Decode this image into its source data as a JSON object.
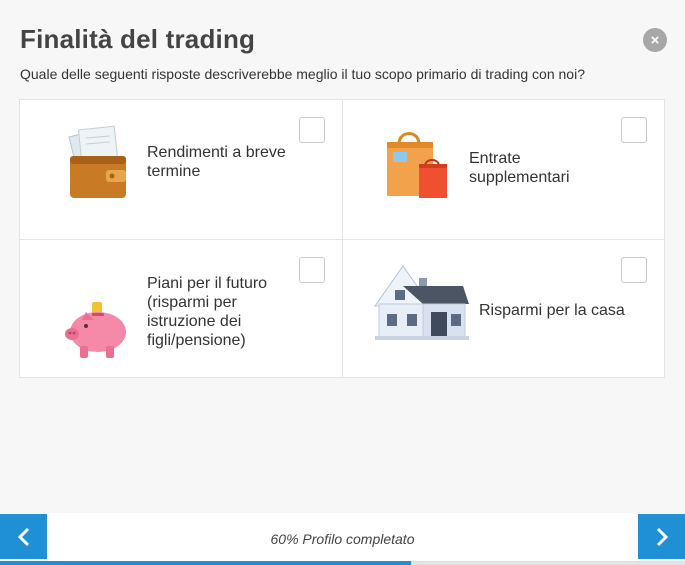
{
  "header": {
    "title": "Finalità del trading",
    "question": "Quale delle seguenti risposte descriverebbe meglio il tuo scopo primario di trading con noi?"
  },
  "close_icon": "×",
  "options": [
    {
      "label": "Rendimenti a breve termine",
      "icon": "wallet-icon",
      "checked": false
    },
    {
      "label": "Entrate supplementari",
      "icon": "shopping-bag-icon",
      "checked": false
    },
    {
      "label": "Piani per il futuro (risparmi per istruzione dei figli/pensione)",
      "icon": "piggy-bank-icon",
      "checked": false
    },
    {
      "label": "Risparmi per la casa",
      "icon": "house-icon",
      "checked": false
    }
  ],
  "footer": {
    "progress_text": "60% Profilo completato",
    "progress_fraction": 0.6,
    "accent": "#1f8fd6"
  }
}
